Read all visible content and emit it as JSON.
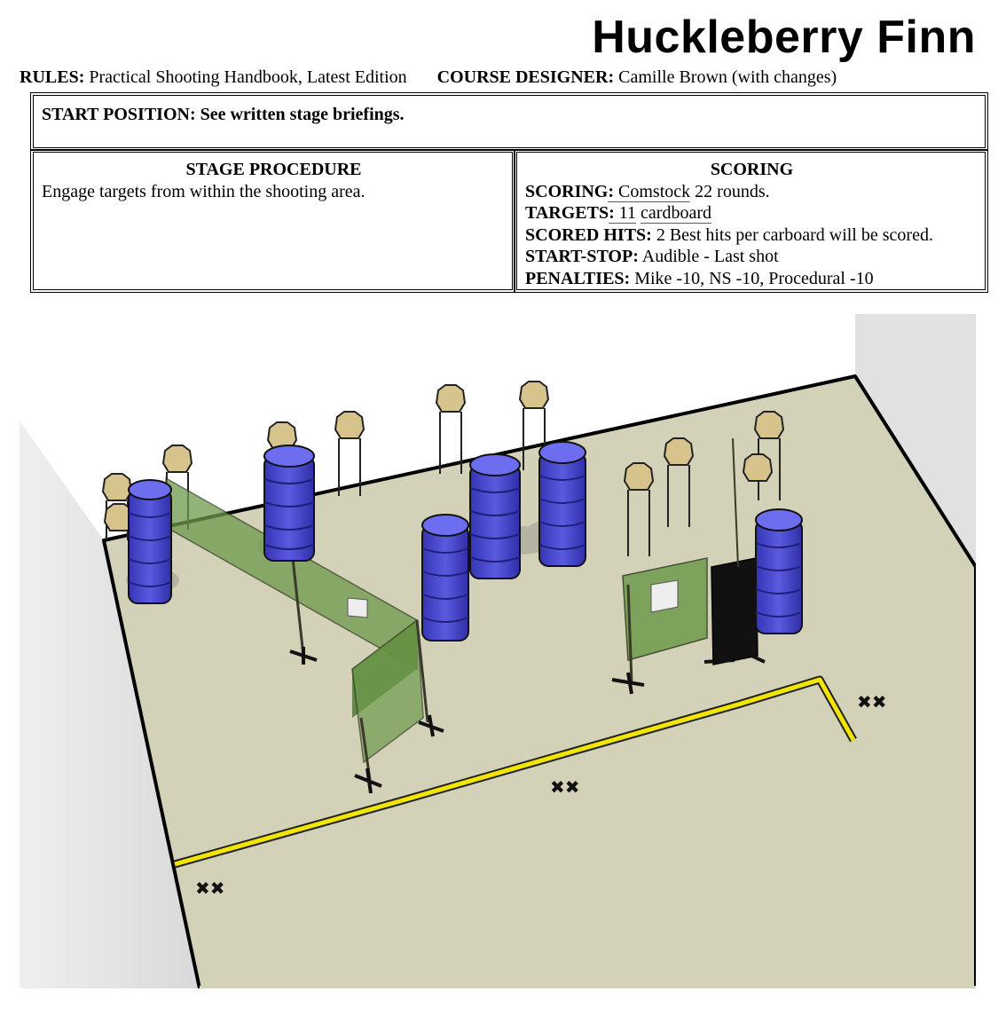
{
  "header": {
    "title": "Huckleberry Finn",
    "rules_label": "RULES:",
    "rules_value": "Practical Shooting Handbook, Latest Edition",
    "designer_label": "COURSE DESIGNER:",
    "designer_value": "Camille Brown (with changes)"
  },
  "start_position": {
    "text": "START POSITION: See written stage briefings."
  },
  "procedure": {
    "heading": "STAGE PROCEDURE",
    "text": "Engage targets from within the shooting area."
  },
  "scoring": {
    "heading": "SCORING",
    "rows": [
      {
        "label": "SCORING",
        "colon": ":",
        "value_ul": " Comstock",
        "value": " 22 rounds."
      },
      {
        "label": "TARGETS",
        "colon": ":",
        "value_ul": " 11",
        "value_ul2": "cardboard"
      },
      {
        "label": "SCORED HITS:",
        "value": " 2 Best hits per carboard will be scored."
      },
      {
        "label": "START-STOP:",
        "value": " Audible - Last shot"
      },
      {
        "label": "PENALTIES:",
        "value": " Mike -10, NS -10, Procedural -10"
      }
    ]
  },
  "diagram": {
    "colors": {
      "floor": "#d4d1b9",
      "wall": "#e4e4e4",
      "barrel": "#4545c8",
      "barrel_top": "#6d6df0",
      "target": "#d7c48c",
      "wall_panel": "#6e9a4c",
      "fault_line": "#f2e600",
      "no_shoot": "#111111"
    },
    "icons": [
      "barrel-icon",
      "cardboard-target-icon",
      "wall-panel-icon",
      "fault-line-icon",
      "start-mark-icon"
    ]
  }
}
